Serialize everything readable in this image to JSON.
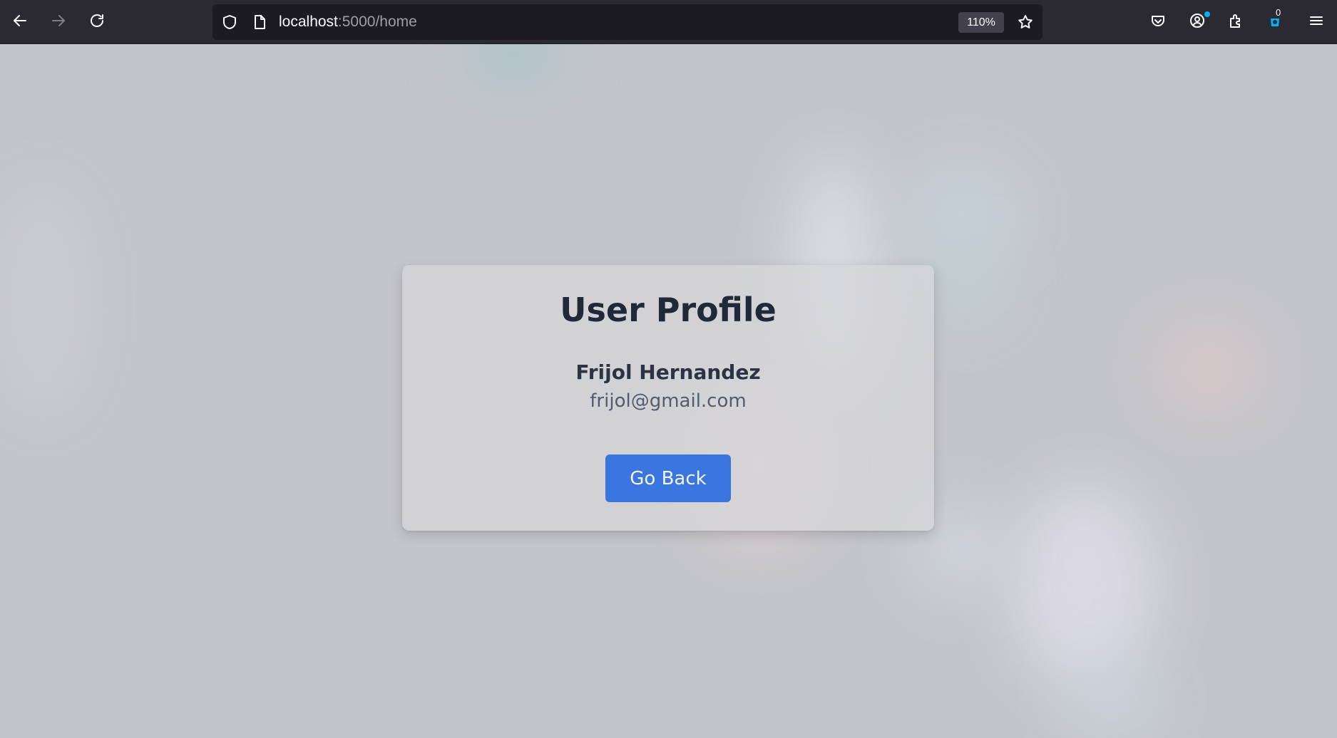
{
  "browser": {
    "url_host": "localhost",
    "url_path": ":5000/home",
    "zoom": "110%",
    "extension_badge_count": "0",
    "icons": {
      "back": "arrow-left-icon",
      "forward": "arrow-right-icon",
      "reload": "reload-icon",
      "tracking": "shield-icon",
      "page": "document-icon",
      "bookmark": "star-icon",
      "pocket": "pocket-icon",
      "account": "account-icon",
      "extensions": "puzzle-icon",
      "extension": "extension-icon",
      "menu": "hamburger-menu-icon"
    }
  },
  "profile": {
    "title": "User Profile",
    "name": "Frijol Hernandez",
    "email": "frijol@gmail.com",
    "back_button": "Go Back"
  },
  "colors": {
    "toolbar": "#2b2a33",
    "urlbar": "#1c1b22",
    "page_background": "#c4c5ca",
    "button": "#3b76e0",
    "title_text": "#212838"
  }
}
